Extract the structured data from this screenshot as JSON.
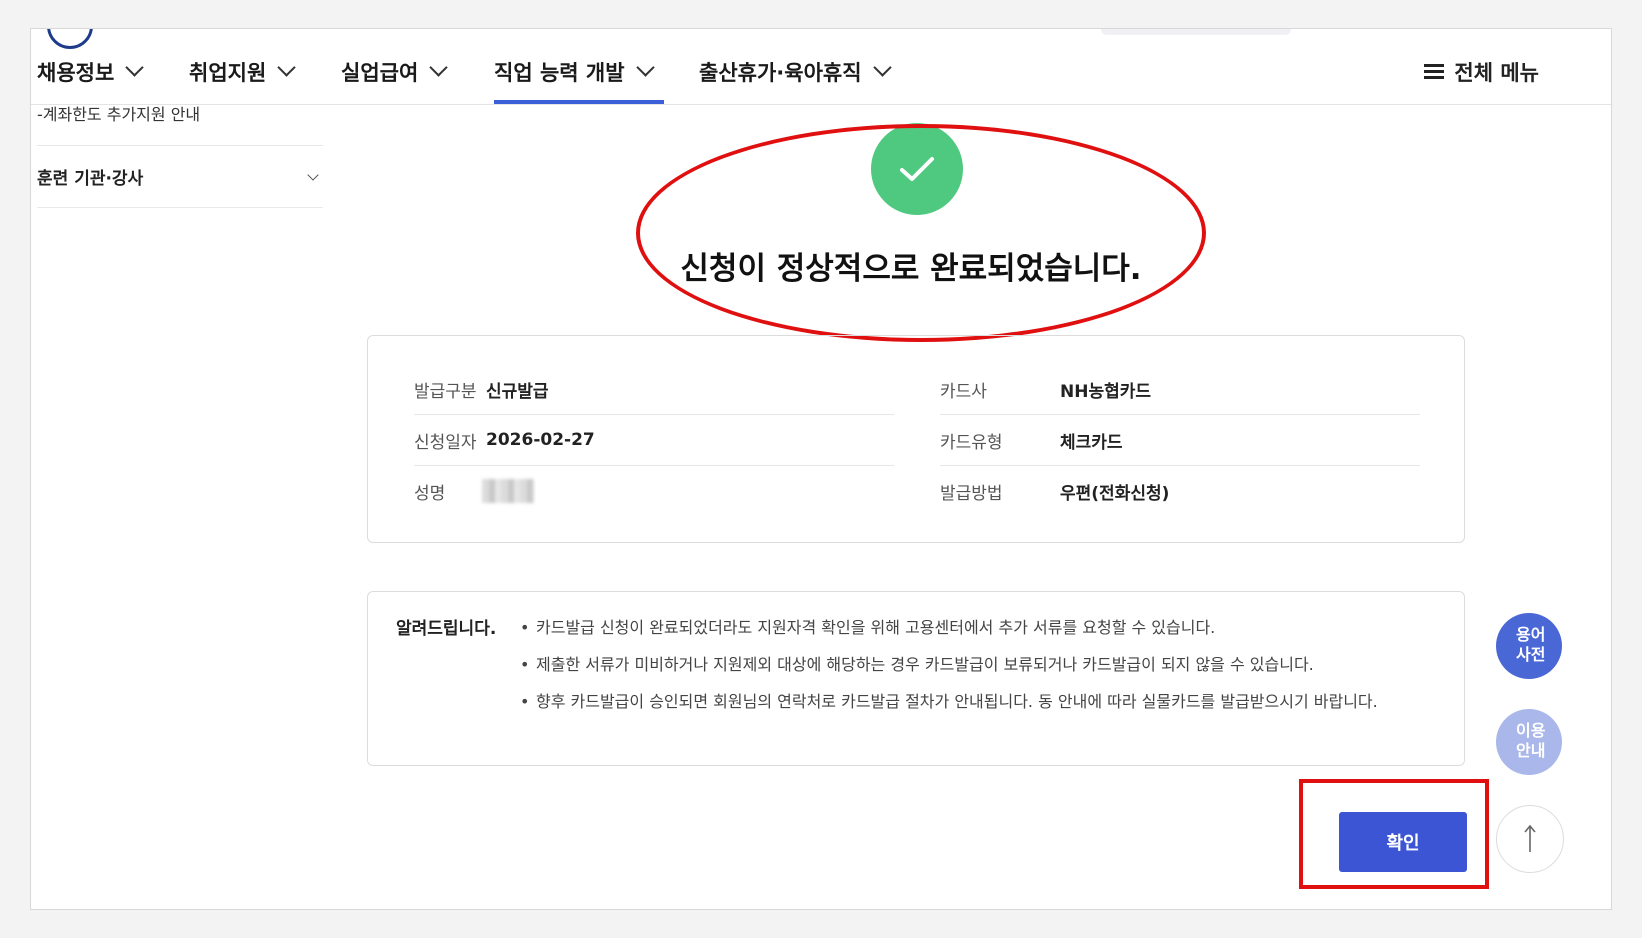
{
  "nav": {
    "items": [
      {
        "label": "채용정보"
      },
      {
        "label": "취업지원"
      },
      {
        "label": "실업급여"
      },
      {
        "label": "직업 능력 개발",
        "active": true
      },
      {
        "label": "출산휴가·육아휴직"
      }
    ],
    "all_menu": "전체 메뉴"
  },
  "sidebar": {
    "sub_item": "-계좌한도 추가지원 안내",
    "group": "훈련 기관·강사"
  },
  "success": {
    "message": "신청이 정상적으로 완료되었습니다.",
    "icon": "check-icon",
    "color": "#4fc97f"
  },
  "details": {
    "issue_type_label": "발급구분",
    "issue_type": "신규발급",
    "apply_date_label": "신청일자",
    "apply_date": "2026-02-27",
    "name_label": "성명",
    "card_company_label": "카드사",
    "card_company": "NH농협카드",
    "card_type_label": "카드유형",
    "card_type": "체크카드",
    "issue_method_label": "발급방법",
    "issue_method": "우편(전화신청)"
  },
  "notice": {
    "title": "알려드립니다.",
    "items": [
      "카드발급 신청이 완료되었더라도 지원자격 확인을 위해 고용센터에서 추가 서류를 요청할 수 있습니다.",
      "제출한 서류가 미비하거나 지원제외 대상에 해당하는 경우 카드발급이 보류되거나 카드발급이 되지 않을 수 있습니다.",
      "향후 카드발급이 승인되면 회원님의 연락처로 카드발급 절차가 안내됩니다. 동 안내에 따라 실물카드를 발급받으시기 바랍니다."
    ]
  },
  "confirm_button": "확인",
  "floating": {
    "dict": "용어\n사전",
    "guide": "이용\n안내"
  },
  "colors": {
    "accent": "#3b55d4",
    "highlight": "#e01010"
  }
}
